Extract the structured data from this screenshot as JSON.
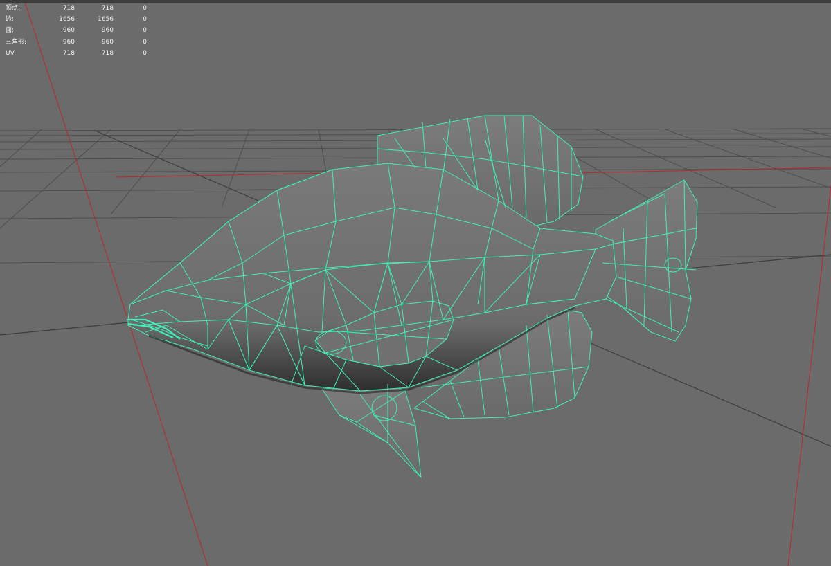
{
  "viewport": {
    "background": "#6b6b6b",
    "wire_color": "#3ff0b8",
    "grid_color": "#4a4a4a",
    "axis_color": "#c0252a"
  },
  "hud": {
    "rows": [
      {
        "label": "顶点:",
        "col1": "718",
        "col2": "718",
        "col3": "0"
      },
      {
        "label": "边:",
        "col1": "1656",
        "col2": "1656",
        "col3": "0"
      },
      {
        "label": "面:",
        "col1": "960",
        "col2": "960",
        "col3": "0"
      },
      {
        "label": "三角形:",
        "col1": "960",
        "col2": "960",
        "col3": "0"
      },
      {
        "label": "UV:",
        "col1": "718",
        "col2": "718",
        "col3": "0"
      }
    ]
  },
  "model": {
    "icon": "fish-wireframe-mesh"
  }
}
